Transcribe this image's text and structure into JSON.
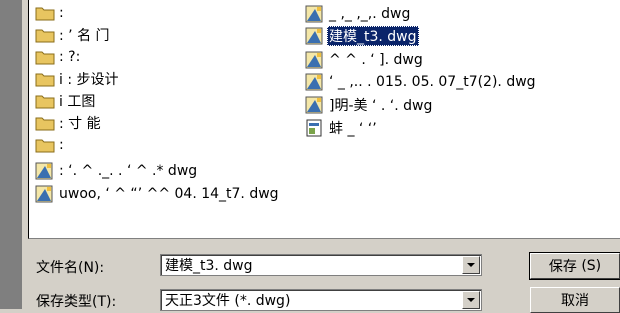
{
  "file_list": {
    "left_column": [
      {
        "type": "folder",
        "name": ":"
      },
      {
        "type": "folder",
        "name": ": ’ 名 门"
      },
      {
        "type": "folder",
        "name": ": ?:"
      },
      {
        "type": "folder",
        "name": "i  :  步设计"
      },
      {
        "type": "folder",
        "name": "  i  工图"
      },
      {
        "type": "folder",
        "name": ": 寸  能"
      },
      {
        "type": "folder",
        "name": ":"
      },
      {
        "type": "dwg",
        "name": ":  ‘.  ^ ._.  .      ‘ ^  .*  dwg"
      },
      {
        "type": "dwg",
        "name": "uwoo,     ‘ ^ “’ ^^ 04. 14_t7. dwg"
      }
    ],
    "right_column": [
      {
        "type": "dwg",
        "name": "_ ,_ ,_,. dwg"
      },
      {
        "type": "dwg",
        "name": "建模_t3. dwg",
        "selected": true
      },
      {
        "type": "dwg",
        "name": "   ^      ^ . ‘    ]. dwg"
      },
      {
        "type": "dwg",
        "name": "   ‘    _  ,.. . 015. 05. 07_t7(2). dwg"
      },
      {
        "type": "dwg",
        "name": "]明-美  ‘  .  ‘. dwg"
      },
      {
        "type": "dwg",
        "name": "蚌     _ ‘ ‘’"
      }
    ]
  },
  "filename_label": "文件名",
  "filename_hotkey": "(N):",
  "filename_value": "建模_t3. dwg",
  "filetype_label": "保存类型",
  "filetype_hotkey": "(T):",
  "filetype_value": "天正3文件 (*. dwg)",
  "save_label": "保存",
  "save_hotkey": "(S)",
  "cancel_label": "取消",
  "colors": {
    "selection": "#0a246a",
    "dialog_bg": "#d4d0c8",
    "folder": "#e8c560"
  }
}
